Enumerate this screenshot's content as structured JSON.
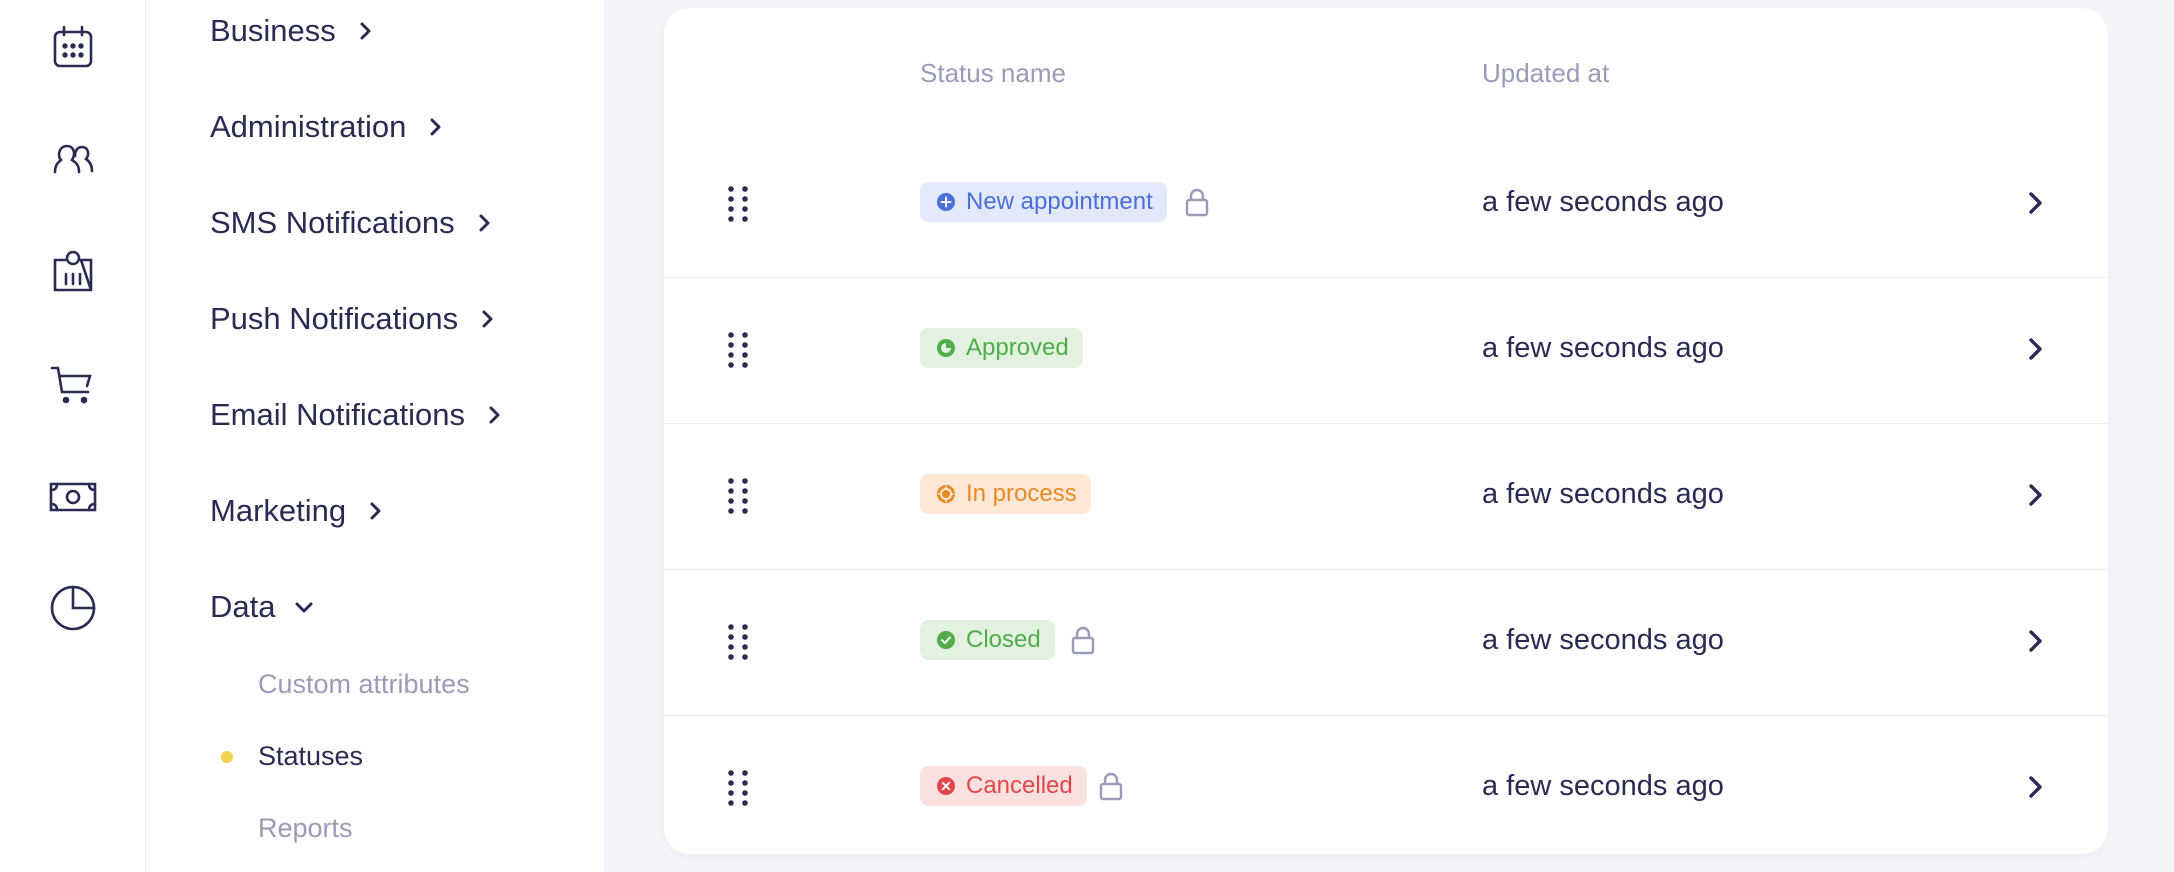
{
  "rail": {
    "icons": [
      "calendar-icon",
      "clients-icon",
      "services-icon",
      "cart-icon",
      "cash-icon",
      "analytics-icon"
    ]
  },
  "nav": {
    "items": [
      {
        "label": "Business",
        "expanded": false
      },
      {
        "label": "Administration",
        "expanded": false
      },
      {
        "label": "SMS Notifications",
        "expanded": false
      },
      {
        "label": "Push Notifications",
        "expanded": false
      },
      {
        "label": "Email Notifications",
        "expanded": false
      },
      {
        "label": "Marketing",
        "expanded": false
      },
      {
        "label": "Data",
        "expanded": true
      }
    ],
    "sub_items": [
      {
        "label": "Custom attributes",
        "active": false
      },
      {
        "label": "Statuses",
        "active": true
      },
      {
        "label": "Reports",
        "active": false
      }
    ]
  },
  "table": {
    "headers": {
      "status_name": "Status name",
      "updated_at": "Updated at"
    },
    "rows": [
      {
        "status": "New appointment",
        "locked": true,
        "updated": "a few seconds ago",
        "icon": "plus-circle-icon",
        "color": "#4a6fd8",
        "bg": "#e3e9fb"
      },
      {
        "status": "Approved",
        "locked": false,
        "updated": "a few seconds ago",
        "icon": "pie-circle-icon",
        "color": "#4fae4a",
        "bg": "#e3f2e0"
      },
      {
        "status": "In process",
        "locked": false,
        "updated": "a few seconds ago",
        "icon": "spinner-circle-icon",
        "color": "#ea8a24",
        "bg": "#fde8d6"
      },
      {
        "status": "Closed",
        "locked": true,
        "updated": "a few seconds ago",
        "icon": "check-circle-icon",
        "color": "#4fae4a",
        "bg": "#e3f2e0"
      },
      {
        "status": "Cancelled",
        "locked": true,
        "updated": "a few seconds ago",
        "icon": "x-circle-icon",
        "color": "#e0474a",
        "bg": "#fbe0e0"
      }
    ]
  },
  "colors": {
    "accent_dot": "#f4d44a",
    "text_primary": "#2a2b52",
    "text_muted": "#9a9bb8"
  }
}
